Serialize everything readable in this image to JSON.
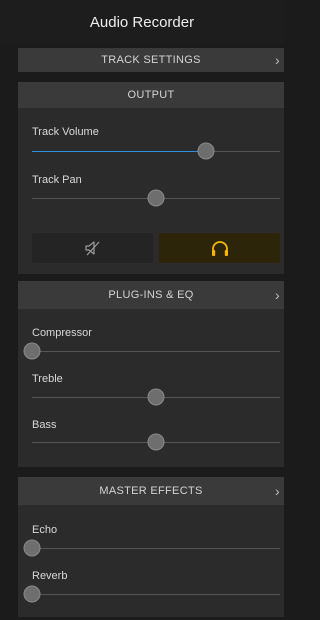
{
  "app": {
    "title": "Audio Recorder"
  },
  "sections": {
    "track_settings": {
      "label": "TRACK SETTINGS",
      "chevron": "chevron-right-icon"
    },
    "output": {
      "label": "OUTPUT"
    },
    "plugins_eq": {
      "label": "PLUG-INS & EQ",
      "chevron": "chevron-right-icon"
    },
    "master_effects": {
      "label": "MASTER EFFECTS",
      "chevron": "chevron-right-icon"
    }
  },
  "sliders": {
    "track_volume": {
      "label": "Track Volume",
      "value": 0.7
    },
    "track_pan": {
      "label": "Track Pan",
      "value": 0.5
    },
    "compressor": {
      "label": "Compressor",
      "value": 0.0
    },
    "treble": {
      "label": "Treble",
      "value": 0.5
    },
    "bass": {
      "label": "Bass",
      "value": 0.5
    },
    "echo": {
      "label": "Echo",
      "value": 0.0
    },
    "reverb": {
      "label": "Reverb",
      "value": 0.0
    }
  },
  "buttons": {
    "mute": {
      "icon": "speaker-mute-icon"
    },
    "monitor": {
      "icon": "headphones-icon",
      "active": true
    }
  },
  "colors": {
    "accent": "#2f8de4",
    "monitor_active": "#f5b800"
  }
}
